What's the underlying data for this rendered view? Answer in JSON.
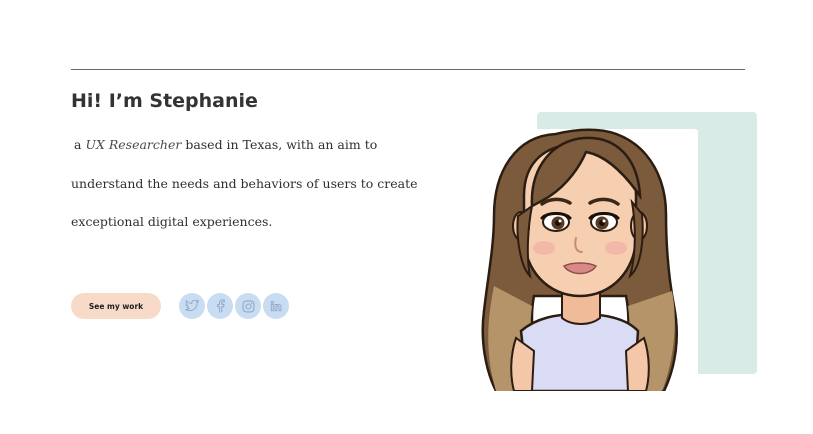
{
  "hero": {
    "greeting": "Hi! I’m Stephanie",
    "intro_prefix": "a",
    "role": "UX Researcher",
    "intro_rest": "based in Texas, with an aim to understand the needs and behaviors of users to create exceptional digital experiences."
  },
  "actions": {
    "see_work_label": "See my work"
  },
  "socials": [
    {
      "icon": "twitter-icon"
    },
    {
      "icon": "facebook-icon"
    },
    {
      "icon": "instagram-icon"
    },
    {
      "icon": "linkedin-icon"
    }
  ],
  "colors": {
    "accent_button": "#f8dac8",
    "social_bg": "#c9ddf2",
    "social_icon": "#8fa8c8",
    "backdrop": "#d9ebe6"
  }
}
